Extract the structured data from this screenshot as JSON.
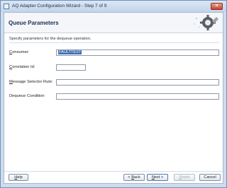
{
  "window": {
    "title": "AQ Adapter Configuration Wizard - Step 7 of 9",
    "close_glyph": "✕"
  },
  "header": {
    "title": "Queue Parameters",
    "icon": "gear-wizard-icon"
  },
  "instruction": "Specify parameters for the dequeue operation.",
  "fields": {
    "consumer": {
      "label_mnemonic": "C",
      "label_rest": "onsumer:",
      "value": "FAULTTEST"
    },
    "correlation_id": {
      "label_mnemonic": "C",
      "label_rest": "orrelation Id:",
      "value": ""
    },
    "message_selector_rule": {
      "label_mnemonic": "M",
      "label_rest": "essage Selector Rule:",
      "value": ""
    },
    "dequeue_condition": {
      "label": "Dequeue Condition",
      "value": ""
    }
  },
  "buttons": {
    "help": {
      "mnemonic": "H",
      "rest": "elp"
    },
    "back": {
      "prefix": "< ",
      "mnemonic": "B",
      "rest": "ack"
    },
    "next": {
      "mnemonic": "N",
      "rest": "ext >"
    },
    "finish": {
      "mnemonic": "F",
      "rest": "inish"
    },
    "cancel": {
      "label": "Cancel"
    }
  },
  "colors": {
    "selection": "#3a6db6",
    "close_button": "#c7432c",
    "title_text": "#1d2f55"
  }
}
